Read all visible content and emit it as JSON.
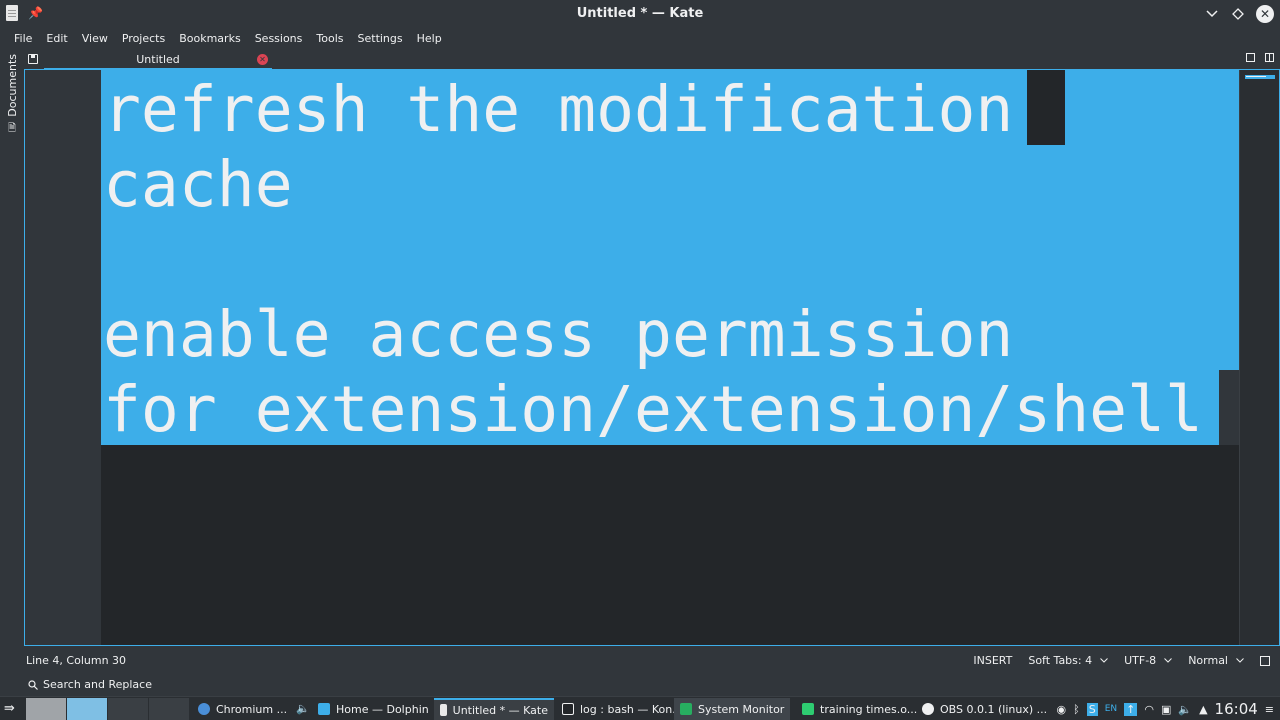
{
  "window": {
    "title": "Untitled * — Kate"
  },
  "menu": {
    "items": [
      "File",
      "Edit",
      "View",
      "Projects",
      "Bookmarks",
      "Sessions",
      "Tools",
      "Settings",
      "Help"
    ]
  },
  "sidebar": {
    "documents_label": "Documents"
  },
  "tabs": {
    "active_label": "Untitled"
  },
  "editor": {
    "lines": [
      "refresh the modification",
      "cache",
      "",
      "enable access permission",
      "for extension/extension/shell"
    ],
    "selection_color": "#3daee9",
    "background": "#232629"
  },
  "status": {
    "position": "Line 4, Column 30",
    "mode": "INSERT",
    "indent": "Soft Tabs: 4",
    "encoding": "UTF-8",
    "highlight": "Normal"
  },
  "search": {
    "label": "Search and Replace"
  },
  "taskbar": {
    "tasks": [
      {
        "label": "Chromium ...",
        "icon": "chromium-icon"
      },
      {
        "label": "Home — Dolphin",
        "icon": "dolphin-icon"
      },
      {
        "label": "Untitled * — Kate",
        "icon": "kate-icon"
      },
      {
        "label": "log : bash — Kon...",
        "icon": "konsole-icon"
      },
      {
        "label": "System Monitor",
        "icon": "system-monitor-icon"
      },
      {
        "label": "training times.o...",
        "icon": "spreadsheet-icon"
      },
      {
        "label": "OBS 0.0.1 (linux) ...",
        "icon": "obs-icon"
      }
    ],
    "tray_lang": "EN",
    "clock": "16:04"
  },
  "colors": {
    "accent": "#3daee9",
    "window_bg": "#31363b",
    "close_tab": "#da4453"
  }
}
